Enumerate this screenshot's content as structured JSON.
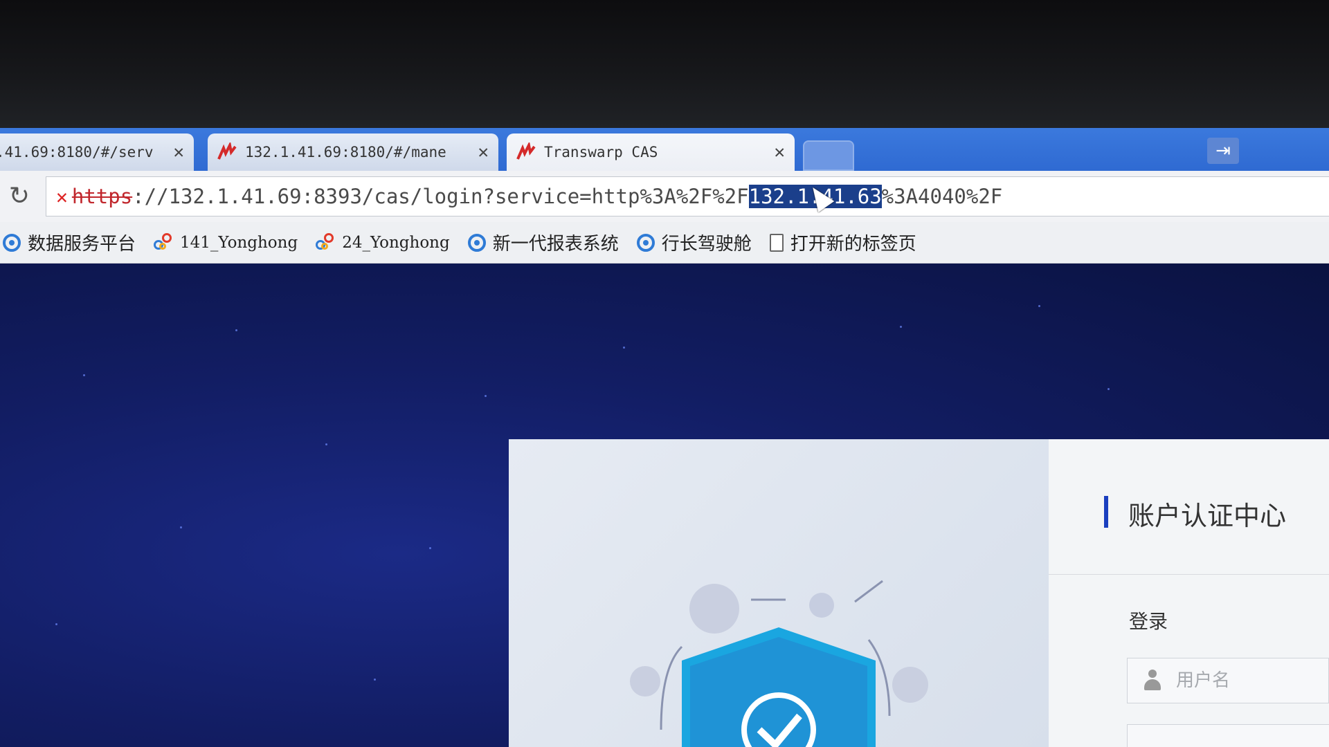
{
  "tabs": [
    {
      "title": ".41.69:8180/#/serv",
      "active": false
    },
    {
      "title": "132.1.41.69:8180/#/mane",
      "active": false
    },
    {
      "title": "Transwarp CAS",
      "active": true
    }
  ],
  "tab_close_glyph": "✕",
  "new_tab_pin_glyph": "⇥",
  "address_bar": {
    "scheme": "https",
    "url_rest_before": "://132.1.41.69:8393/cas/login?service=http%3A%2F%2F",
    "url_selected": "132.1.41.63",
    "url_rest_after": "%3A4040%2F"
  },
  "bookmarks": [
    {
      "label": "数据服务平台",
      "icon": "data-service-icon"
    },
    {
      "label": "141_Yonghong",
      "icon": "yonghong-icon"
    },
    {
      "label": "24_Yonghong",
      "icon": "yonghong-icon"
    },
    {
      "label": "新一代报表系统",
      "icon": "report-system-icon"
    },
    {
      "label": "行长驾驶舱",
      "icon": "dashboard-icon"
    },
    {
      "label": "打开新的标签页",
      "icon": "page-icon"
    }
  ],
  "login": {
    "heading": "账户认证中心",
    "login_label": "登录",
    "username_placeholder": "用户名"
  },
  "colors": {
    "tabbar": "#2f6ad2",
    "page_background": "#121d63",
    "accent": "#1a3fbf",
    "shield": "#1aa6e0"
  }
}
